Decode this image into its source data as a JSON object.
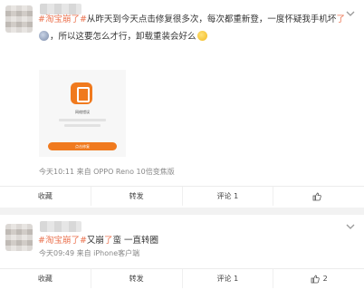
{
  "post1": {
    "tag": "#淘宝崩了#",
    "text_a": "从昨天到今天点击修复很多次，每次都重新登，一度怀疑我手机坏",
    "text_red": "了",
    "text_b": "，所以这要怎么才行，卸载重装会好么",
    "screenshot": {
      "title": "网络错误",
      "button": "点击修复"
    },
    "meta": "今天10:11 来自 OPPO Reno 10倍变焦版",
    "actions": {
      "collect": "收藏",
      "forward": "转发",
      "comment": "评论 1",
      "like_count": ""
    }
  },
  "post2": {
    "tag": "#淘宝崩了#",
    "text_a": "又崩",
    "text_red": "了",
    "text_b": "蛮 一直转圈",
    "meta": "今天09:49 来自 iPhone客户端",
    "actions": {
      "collect": "收藏",
      "forward": "转发",
      "comment": "评论 1",
      "like_count": "2"
    }
  },
  "colors": {
    "tag": "#eb7350",
    "accent": "#f07a1e"
  }
}
